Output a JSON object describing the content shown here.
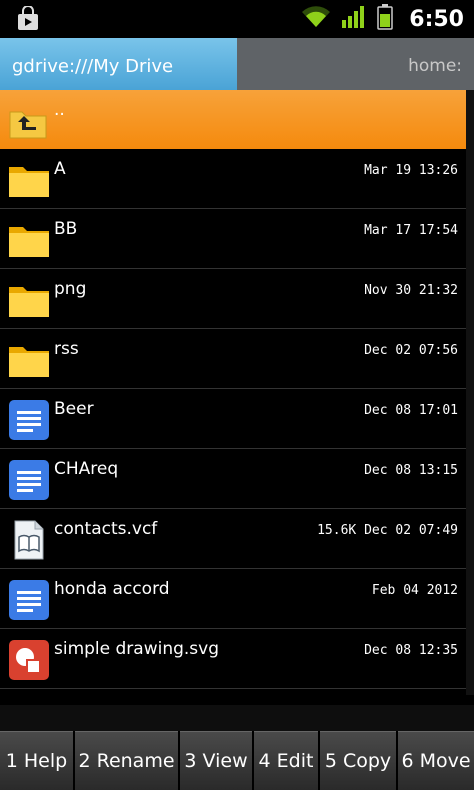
{
  "status": {
    "time": "6:50",
    "icons": [
      "store-icon",
      "wifi-icon",
      "signal-icon",
      "battery-icon"
    ]
  },
  "tabs": {
    "active": "gdrive:///My Drive",
    "inactive": "home:"
  },
  "files": [
    {
      "name": "..",
      "meta": "",
      "icon": "parent-folder-icon"
    },
    {
      "name": "A",
      "meta": "Mar 19 13:26",
      "icon": "folder-icon"
    },
    {
      "name": "BB",
      "meta": "Mar 17 17:54",
      "icon": "folder-icon"
    },
    {
      "name": "png",
      "meta": "Nov 30 21:32",
      "icon": "folder-icon"
    },
    {
      "name": "rss",
      "meta": "Dec 02 07:56",
      "icon": "folder-icon"
    },
    {
      "name": "Beer",
      "meta": "Dec 08 17:01",
      "icon": "doc-icon"
    },
    {
      "name": "CHAreq",
      "meta": "Dec 08 13:15",
      "icon": "doc-icon"
    },
    {
      "name": "contacts.vcf",
      "meta": "15.6K Dec 02 07:49",
      "icon": "vcard-icon"
    },
    {
      "name": "honda accord",
      "meta": "Feb 04  2012",
      "icon": "doc-icon"
    },
    {
      "name": "simple drawing.svg",
      "meta": "Dec 08 12:35",
      "icon": "drawing-icon"
    }
  ],
  "fkeys": [
    "1 Help",
    "2 Rename",
    "3 View",
    "4 Edit",
    "5 Copy",
    "6 Move"
  ],
  "colors": {
    "accent": "#4aa3d6",
    "selected": "#f58a0d"
  }
}
